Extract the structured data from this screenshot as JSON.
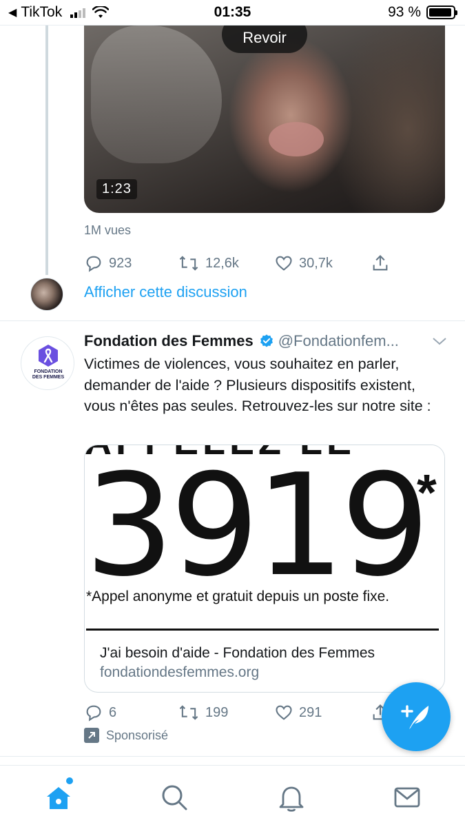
{
  "status_bar": {
    "back_app": "TikTok",
    "time": "01:35",
    "battery": "93 %",
    "battery_level": 0.93
  },
  "video_tweet": {
    "replay_label": "Revoir",
    "duration": "1:23",
    "views": "1M vues",
    "replies": "923",
    "retweets": "12,6k",
    "likes": "30,7k",
    "show_thread": "Afficher cette discussion"
  },
  "promoted_tweet": {
    "avatar_text_line1": "FONDATION",
    "avatar_text_line2": "DES FEMMES",
    "name": "Fondation des Femmes",
    "handle": "@Fondationfem...",
    "text": "Victimes de violences, vous souhaitez en parler, demander de l'aide ? Plusieurs dispositifs existent, vous n'êtes pas seules. Retrouvez-les sur notre site :",
    "card": {
      "image_top_text": "APPELEZ LE",
      "image_number": "3919",
      "image_asterisk": "*",
      "image_note": "*Appel anonyme et gratuit depuis un poste fixe.",
      "title": "J'ai besoin d'aide - Fondation des Femmes",
      "domain": "fondationdesfemmes.org"
    },
    "replies": "6",
    "retweets": "199",
    "likes": "291",
    "sponsored_label": "Sponsorisé"
  },
  "tab_bar": {
    "items": [
      "home-icon",
      "search-icon",
      "notifications-icon",
      "messages-icon"
    ]
  },
  "colors": {
    "accent": "#1da1f2",
    "secondary_text": "#657786"
  }
}
